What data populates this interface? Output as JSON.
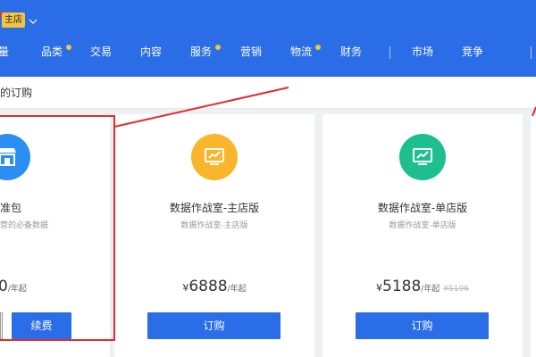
{
  "header": {
    "store_tag": "主店",
    "nav": [
      {
        "label": "量"
      },
      {
        "label": "品类",
        "dot": true
      },
      {
        "label": "交易"
      },
      {
        "label": "内容"
      },
      {
        "label": "服务",
        "dot": true
      },
      {
        "label": "营销"
      },
      {
        "label": "物流",
        "dot": true
      },
      {
        "label": "财务"
      },
      {
        "label": "市场"
      },
      {
        "label": "竞争"
      }
    ]
  },
  "subbar": {
    "text": "的订购"
  },
  "cards": [
    {
      "icon": "store-icon",
      "icon_color": "#2b8ef3",
      "title": "准包",
      "subtitle": "营的必备数据",
      "price_number": "0",
      "price_unit": "/年起",
      "buttons": [
        "续费"
      ]
    },
    {
      "icon": "chart-monitor-icon",
      "icon_color": "#f9b62b",
      "title": "数据作战室-主店版",
      "subtitle": "数据作战室-主店版",
      "price_currency": "¥",
      "price_number": "6888",
      "price_unit": "/年起",
      "buttons": [
        "订购"
      ]
    },
    {
      "icon": "chart-monitor-icon",
      "icon_color": "#1dbf8e",
      "title": "数据作战室-单店版",
      "subtitle": "数据作战室-单店版",
      "price_currency": "¥",
      "price_number": "5188",
      "price_unit": "/年起",
      "price_old": "¥5196",
      "buttons": [
        "订购"
      ]
    }
  ],
  "colors": {
    "brand_blue": "#2b6de7",
    "annotation_red": "#e42b2b",
    "badge_yellow": "#f4c43a"
  }
}
